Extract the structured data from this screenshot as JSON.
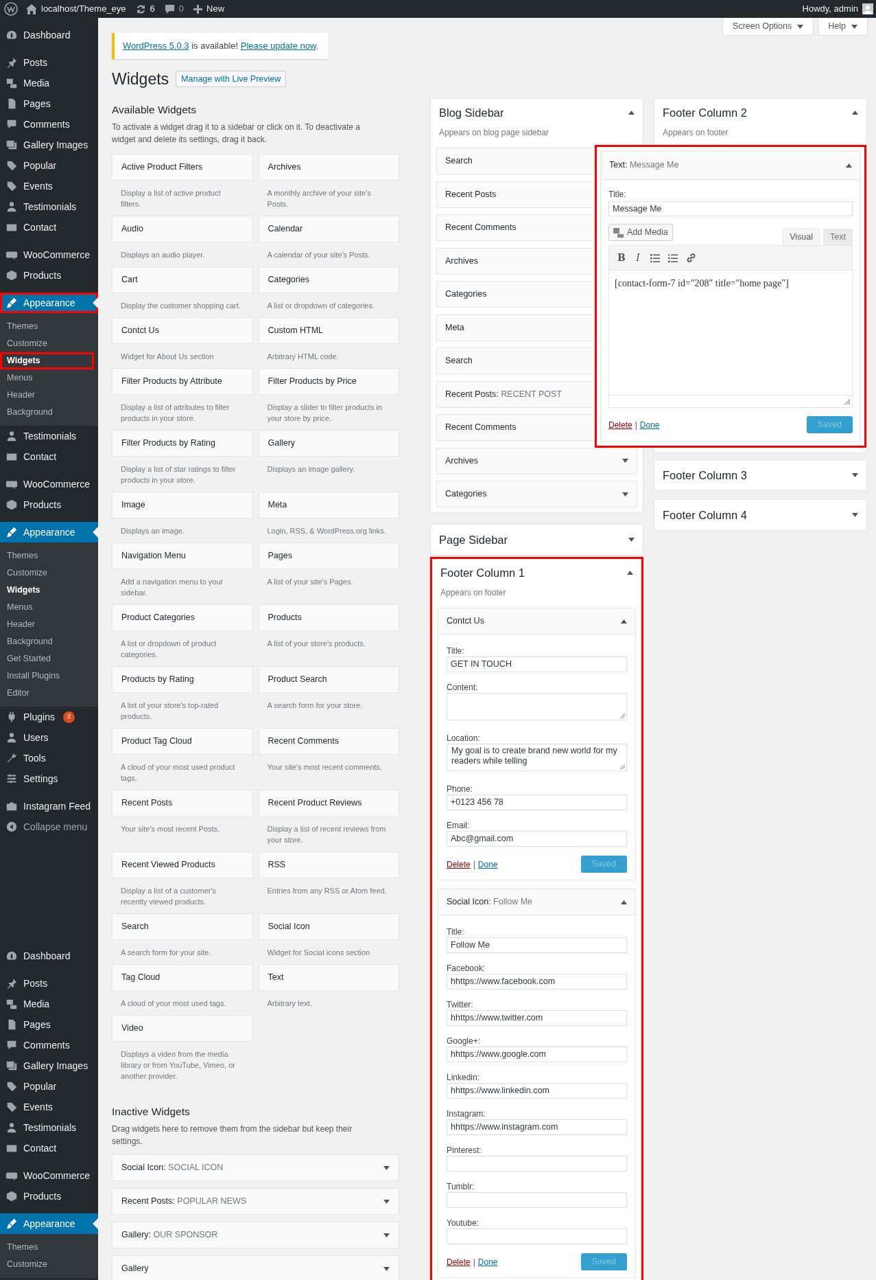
{
  "admin_bar": {
    "site": "localhost/Theme_eye",
    "updates": "6",
    "comments": "0",
    "new": "New",
    "greeting": "Howdy, admin"
  },
  "sidebar": {
    "sections": [
      {
        "groups": [
          {
            "items": [
              {
                "label": "Dashboard",
                "selected": false,
                "highlighted": false
              }
            ]
          },
          {
            "items": [
              {
                "label": "Posts",
                "selected": false,
                "highlighted": false
              },
              {
                "label": "Media",
                "selected": false,
                "highlighted": false
              },
              {
                "label": "Pages",
                "selected": false,
                "highlighted": false
              },
              {
                "label": "Comments",
                "selected": false,
                "highlighted": false
              },
              {
                "label": "Gallery Images",
                "selected": false,
                "highlighted": false
              },
              {
                "label": "Popular",
                "selected": false,
                "highlighted": false
              },
              {
                "label": "Events",
                "selected": false,
                "highlighted": false
              },
              {
                "label": "Testimonials",
                "selected": false,
                "highlighted": false
              },
              {
                "label": "Contact",
                "selected": false,
                "highlighted": false
              }
            ]
          },
          {
            "items": [
              {
                "label": "WooCommerce",
                "selected": false,
                "highlighted": false
              },
              {
                "label": "Products",
                "selected": false,
                "highlighted": false
              }
            ]
          },
          {
            "items": [
              {
                "label": "Appearance",
                "selected": true,
                "highlighted": true,
                "children": [
                  {
                    "label": "Themes",
                    "selected": false,
                    "highlighted": false
                  },
                  {
                    "label": "Customize",
                    "selected": false,
                    "highlighted": false
                  },
                  {
                    "label": "Widgets",
                    "selected": true,
                    "highlighted": true
                  },
                  {
                    "label": "Menus",
                    "selected": false,
                    "highlighted": false
                  },
                  {
                    "label": "Header",
                    "selected": false,
                    "highlighted": false
                  },
                  {
                    "label": "Background",
                    "selected": false,
                    "highlighted": false
                  }
                ]
              },
              {
                "label": "Testimonials",
                "selected": false,
                "highlighted": false
              },
              {
                "label": "Contact",
                "selected": false,
                "highlighted": false
              }
            ]
          },
          {
            "items": [
              {
                "label": "WooCommerce",
                "selected": false,
                "highlighted": false
              },
              {
                "label": "Products",
                "selected": false,
                "highlighted": false
              }
            ]
          },
          {
            "items": [
              {
                "label": "Appearance",
                "selected": true,
                "highlighted": false,
                "children": [
                  {
                    "label": "Themes",
                    "selected": false,
                    "highlighted": false
                  },
                  {
                    "label": "Customize",
                    "selected": false,
                    "highlighted": false
                  },
                  {
                    "label": "Widgets",
                    "selected": true,
                    "highlighted": false
                  },
                  {
                    "label": "Menus",
                    "selected": false,
                    "highlighted": false
                  },
                  {
                    "label": "Header",
                    "selected": false,
                    "highlighted": false
                  },
                  {
                    "label": "Background",
                    "selected": false,
                    "highlighted": false
                  },
                  {
                    "label": "Get Started",
                    "selected": false,
                    "highlighted": false
                  },
                  {
                    "label": "Install Plugins",
                    "selected": false,
                    "highlighted": false
                  },
                  {
                    "label": "Editor",
                    "selected": false,
                    "highlighted": false
                  }
                ]
              },
              {
                "label": "Plugins",
                "badge": "2",
                "selected": false,
                "highlighted": false
              },
              {
                "label": "Users",
                "selected": false,
                "highlighted": false
              },
              {
                "label": "Tools",
                "selected": false,
                "highlighted": false
              },
              {
                "label": "Settings",
                "selected": false,
                "highlighted": false
              }
            ]
          },
          {
            "items": [
              {
                "label": "Instagram Feed",
                "selected": false,
                "highlighted": false
              },
              {
                "label": "Collapse menu",
                "selected": false,
                "highlighted": false
              }
            ]
          }
        ]
      },
      {
        "groups": [
          {
            "items": [
              {
                "label": "Dashboard",
                "selected": false,
                "highlighted": false
              }
            ]
          },
          {
            "items": [
              {
                "label": "Posts",
                "selected": false,
                "highlighted": false
              },
              {
                "label": "Media",
                "selected": false,
                "highlighted": false
              },
              {
                "label": "Pages",
                "selected": false,
                "highlighted": false
              },
              {
                "label": "Comments",
                "selected": false,
                "highlighted": false
              },
              {
                "label": "Gallery Images",
                "selected": false,
                "highlighted": false
              },
              {
                "label": "Popular",
                "selected": false,
                "highlighted": false
              },
              {
                "label": "Events",
                "selected": false,
                "highlighted": false
              },
              {
                "label": "Testimonials",
                "selected": false,
                "highlighted": false
              },
              {
                "label": "Contact",
                "selected": false,
                "highlighted": false
              }
            ]
          },
          {
            "items": [
              {
                "label": "WooCommerce",
                "selected": false,
                "highlighted": false
              },
              {
                "label": "Products",
                "selected": false,
                "highlighted": false
              }
            ]
          },
          {
            "items": [
              {
                "label": "Appearance",
                "selected": true,
                "highlighted": false,
                "children": [
                  {
                    "label": "Themes",
                    "selected": false,
                    "highlighted": false
                  },
                  {
                    "label": "Customize",
                    "selected": false,
                    "highlighted": false
                  }
                ]
              }
            ]
          }
        ]
      }
    ]
  },
  "screen_tabs": [
    "Screen Options",
    "Help"
  ],
  "notice": {
    "link": "WordPress 5.0.3",
    "text": " is available! ",
    "action": "Please update now",
    "end": "."
  },
  "page_title": "Widgets",
  "title_action": "Manage with Live Preview",
  "available": {
    "heading": "Available Widgets",
    "description": "To activate a widget drag it to a sidebar or click on it. To deactivate a widget and delete its settings, drag it back.",
    "widgets": [
      {
        "name": "Active Product Filters",
        "description": "Display a list of active product filters."
      },
      {
        "name": "Archives",
        "description": "A monthly archive of your site's Posts."
      },
      {
        "name": "Audio",
        "description": "Displays an audio player."
      },
      {
        "name": "Calendar",
        "description": "A calendar of your site's Posts."
      },
      {
        "name": "Cart",
        "description": "Display the customer shopping cart."
      },
      {
        "name": "Categories",
        "description": "A list or dropdown of categories."
      },
      {
        "name": "Contct Us",
        "description": "Widget for About Us section"
      },
      {
        "name": "Custom HTML",
        "description": "Arbitrary HTML code."
      },
      {
        "name": "Filter Products by Attribute",
        "description": "Display a list of attributes to filter products in your store."
      },
      {
        "name": "Filter Products by Price",
        "description": "Display a slider to filter products in your store by price."
      },
      {
        "name": "Filter Products by Rating",
        "description": "Display a list of star ratings to filter products in your store."
      },
      {
        "name": "Gallery",
        "description": "Displays an image gallery."
      },
      {
        "name": "Image",
        "description": "Displays an image."
      },
      {
        "name": "Meta",
        "description": "Login, RSS, & WordPress.org links."
      },
      {
        "name": "Navigation Menu",
        "description": "Add a navigation menu to your sidebar."
      },
      {
        "name": "Pages",
        "description": "A list of your site's Pages."
      },
      {
        "name": "Product Categories",
        "description": "A list or dropdown of product categories."
      },
      {
        "name": "Products",
        "description": "A list of your store's products."
      },
      {
        "name": "Products by Rating",
        "description": "A list of your store's top-rated products."
      },
      {
        "name": "Product Search",
        "description": "A search form for your store."
      },
      {
        "name": "Product Tag Cloud",
        "description": "A cloud of your most used product tags."
      },
      {
        "name": "Recent Comments",
        "description": "Your site's most recent comments."
      },
      {
        "name": "Recent Posts",
        "description": "Your site's most recent Posts."
      },
      {
        "name": "Recent Product Reviews",
        "description": "Display a list of recent reviews from your store."
      },
      {
        "name": "Recent Viewed Products",
        "description": "Display a list of a customer's recently viewed products."
      },
      {
        "name": "RSS",
        "description": "Entries from any RSS or Atom feed."
      },
      {
        "name": "Search",
        "description": "A search form for your site."
      },
      {
        "name": "Social Icon",
        "description": "Widget for Social icons section"
      },
      {
        "name": "Tag Cloud",
        "description": "A cloud of your most used tags."
      },
      {
        "name": "Text",
        "description": "Arbitrary text."
      },
      {
        "name": "Video",
        "description": "Displays a video from the media library or from YouTube, Vimeo, or another provider."
      }
    ]
  },
  "inactive": {
    "heading": "Inactive Widgets",
    "description": "Drag widgets here to remove them from the sidebar but keep their settings.",
    "widgets": [
      {
        "title": "Social Icon:",
        "subtitle": "SOCIAL ICON"
      },
      {
        "title": "Recent Posts:",
        "subtitle": "POPULAR NEWS"
      },
      {
        "title": "Gallery:",
        "subtitle": "OUR SPONSOR"
      },
      {
        "title": "Gallery"
      }
    ]
  },
  "columns": [
    [
      {
        "title": "Blog Sidebar",
        "description": "Appears on blog page sidebar",
        "expanded": true,
        "highlighted": false,
        "widgets": [
          {
            "kind": "collapsed",
            "title": "Search"
          },
          {
            "kind": "collapsed",
            "title": "Recent Posts"
          },
          {
            "kind": "collapsed",
            "title": "Recent Comments"
          },
          {
            "kind": "collapsed",
            "title": "Archives"
          },
          {
            "kind": "collapsed",
            "title": "Categories"
          },
          {
            "kind": "collapsed",
            "title": "Meta"
          },
          {
            "kind": "collapsed",
            "title": "Search"
          },
          {
            "kind": "collapsed",
            "title": "Recent Posts:",
            "subtitle": "RECENT POST"
          },
          {
            "kind": "collapsed",
            "title": "Recent Comments"
          },
          {
            "kind": "collapsed",
            "title": "Archives"
          },
          {
            "kind": "collapsed",
            "title": "Categories"
          }
        ]
      },
      {
        "title": "Page Sidebar",
        "expanded": false,
        "highlighted": false
      },
      {
        "title": "Footer Column 1",
        "description": "Appears on footer",
        "expanded": true,
        "highlighted": true,
        "widgets": [
          {
            "kind": "form",
            "title": "Contct Us",
            "fields": [
              {
                "label": "Title:",
                "kind": "input",
                "value": "GET IN TOUCH"
              },
              {
                "label": "Content:",
                "kind": "textarea"
              },
              {
                "label": "Location:",
                "kind": "textarea",
                "value": "My goal is to create brand new world for my readers while telling"
              },
              {
                "label": "Phone:",
                "kind": "input",
                "value": "+0123 456 78"
              },
              {
                "label": "Email:",
                "kind": "input",
                "value": "Abc@gmail.com"
              }
            ],
            "actions": {
              "delete": "Delete",
              "separator": "|",
              "done": "Done",
              "save": "Saved",
              "save_disabled": true
            }
          },
          {
            "kind": "form",
            "title": "Social Icon:",
            "subtitle": "Follow Me",
            "fields": [
              {
                "label": "Title:",
                "kind": "input",
                "value": "Follow Me"
              },
              {
                "label": "Facebook:",
                "kind": "input",
                "value": "hhttps://www.facebook.com"
              },
              {
                "label": "Twitter:",
                "kind": "input",
                "value": "hhttps://www.twitter.com"
              },
              {
                "label": "Google+:",
                "kind": "input",
                "value": "hhttps://www.google.com"
              },
              {
                "label": "Linkedin:",
                "kind": "input",
                "value": "hhttps://www.linkedin.com"
              },
              {
                "label": "Instagram:",
                "kind": "input",
                "value": "hhttps://www.instagram.com"
              },
              {
                "label": "Pinterest:",
                "kind": "input"
              },
              {
                "label": "Tumblr:",
                "kind": "input"
              },
              {
                "label": "Youtube:",
                "kind": "input"
              }
            ],
            "actions": {
              "delete": "Delete",
              "separator": "|",
              "done": "Done",
              "save": "Saved",
              "save_disabled": true
            }
          }
        ]
      }
    ],
    [
      {
        "title": "Footer Column 2",
        "description": "Appears on footer",
        "expanded": true,
        "highlighted": false,
        "widgets": [
          {
            "kind": "editor",
            "title": "Text:",
            "subtitle": "Message Me",
            "highlighted": true,
            "title_label": "Title:",
            "title_value": "Message Me",
            "add_media": "Add Media",
            "tabs": [
              {
                "label": "Visual",
                "selected": true
              },
              {
                "label": "Text",
                "selected": false
              }
            ],
            "toolbar": [
              "B",
              "I"
            ],
            "content": "[contact-form-7 id=\"208\" title=\"home page\"]",
            "actions": {
              "delete": "Delete",
              "separator": "|",
              "done": "Done",
              "save": "Saved",
              "save_disabled": true
            }
          }
        ]
      },
      {
        "title": "Footer Column 3",
        "expanded": false,
        "highlighted": false
      },
      {
        "title": "Footer Column 4",
        "expanded": false,
        "highlighted": false
      }
    ]
  ]
}
